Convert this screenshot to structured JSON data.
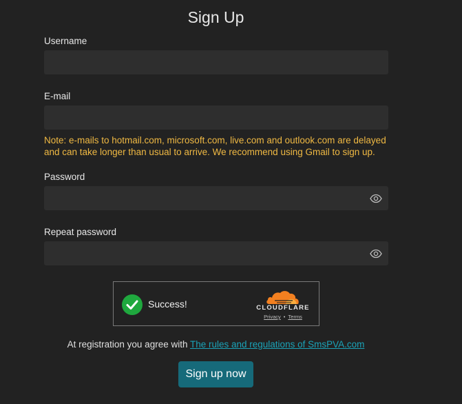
{
  "form": {
    "title": "Sign Up",
    "username": {
      "label": "Username",
      "value": "",
      "placeholder": ""
    },
    "email": {
      "label": "E-mail",
      "value": "",
      "placeholder": ""
    },
    "note": "Note: e-mails to hotmail.com, microsoft.com, live.com and outlook.com are delayed and can take longer than usual to arrive. We recommend using Gmail to sign up.",
    "password": {
      "label": "Password",
      "value": "",
      "placeholder": ""
    },
    "repeat_password": {
      "label": "Repeat password",
      "value": "",
      "placeholder": ""
    },
    "agree_text": "At registration you agree with",
    "rules_link": "The rules and regulations of SmsPVA.com",
    "submit_label": "Sign up now"
  },
  "captcha": {
    "status": "Success!",
    "brand": "CLOUDFLARE",
    "privacy_link": "Privacy",
    "separator": "•",
    "terms_link": "Terms"
  },
  "icons": {
    "password_toggle": "eye-icon",
    "repeat_password_toggle": "eye-icon",
    "captcha_status": "checkmark-icon",
    "captcha_brand": "cloudflare-logo"
  },
  "colors": {
    "background": "#222222",
    "field_background": "#2e2e2e",
    "note": "#f0b943",
    "link": "#1aa3b8",
    "button": "#166a7a",
    "success_green": "#1fa83e",
    "cloudflare_orange": "#f38020"
  }
}
